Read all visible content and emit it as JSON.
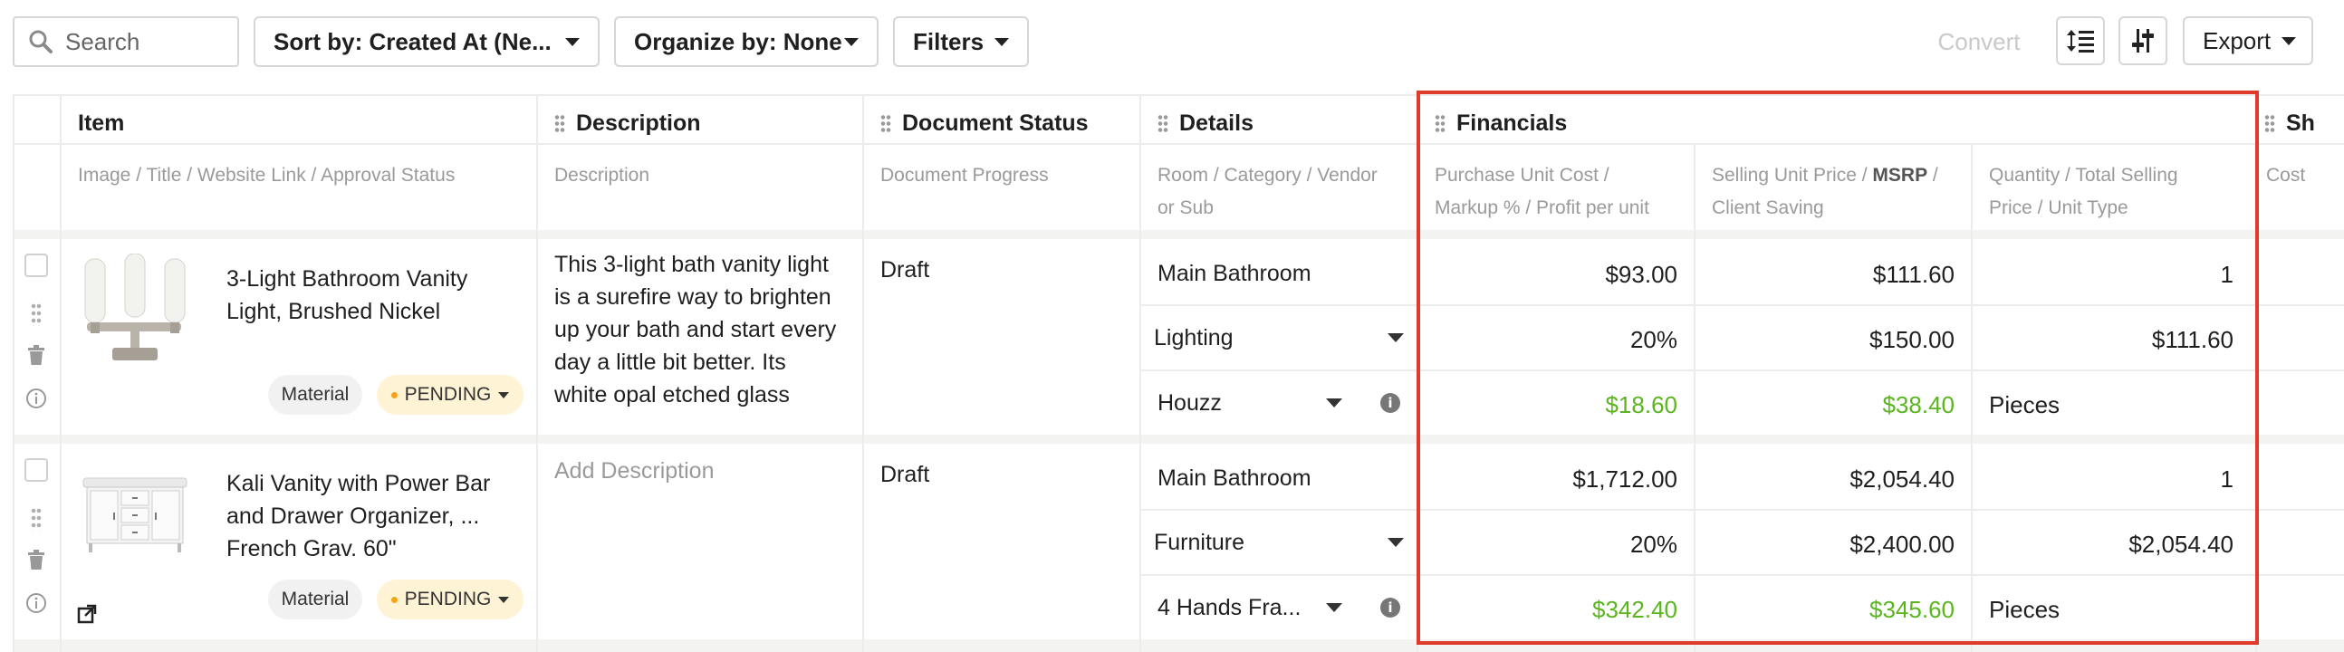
{
  "toolbar": {
    "search_placeholder": "Search",
    "sort_label": "Sort by: Created At (Ne...",
    "organize_label": "Organize by: None",
    "filters_label": "Filters",
    "convert_label": "Convert",
    "export_label": "Export"
  },
  "columns": {
    "item": {
      "title": "Item",
      "sub": "Image / Title / Website Link / Approval Status"
    },
    "description": {
      "title": "Description",
      "sub": "Description"
    },
    "document_status": {
      "title": "Document Status",
      "sub": "Document Progress"
    },
    "details": {
      "title": "Details",
      "sub_line1": "Room / Category / Vendor",
      "sub_line2": "or Sub"
    },
    "financials": {
      "title": "Financials"
    },
    "purchase": {
      "sub_line1": "Purchase Unit Cost /",
      "sub_line2": "Markup % / Profit per unit"
    },
    "selling": {
      "sub_a": "Selling Unit Price / ",
      "sub_bold": "MSRP",
      "sub_b": " /",
      "sub_line2": "Client Saving"
    },
    "quantity": {
      "sub_line1": "Quantity / Total Selling",
      "sub_line2": "Price / Unit Type"
    },
    "shipping": {
      "title": "Sh",
      "sub": "Cost"
    }
  },
  "rows": [
    {
      "title_line1": "3-Light Bathroom Vanity",
      "title_line2": "Light, Brushed Nickel",
      "title_line3": "",
      "type_badge": "Material",
      "status_badge": "PENDING",
      "description_lines": [
        "This 3-light bath vanity light",
        "is a surefire way to brighten",
        "up your bath and start every",
        "day a little bit better. Its",
        "white opal etched glass"
      ],
      "document_status": "Draft",
      "room": "Main Bathroom",
      "category": "Lighting",
      "vendor": "Houzz",
      "purchase_unit_cost": "$93.00",
      "markup": "20%",
      "profit_per_unit": "$18.60",
      "selling_unit_price": "$111.60",
      "msrp": "$150.00",
      "client_saving": "$38.40",
      "quantity": "1",
      "total_selling_price": "$111.60",
      "unit_type": "Pieces"
    },
    {
      "title_line1": "Kali Vanity with Power Bar",
      "title_line2": "and Drawer Organizer, ...",
      "title_line3": "French Grav. 60\"",
      "type_badge": "Material",
      "status_badge": "PENDING",
      "description_placeholder": "Add Description",
      "document_status": "Draft",
      "room": "Main Bathroom",
      "category": "Furniture",
      "vendor": "4 Hands Fra...",
      "purchase_unit_cost": "$1,712.00",
      "markup": "20%",
      "profit_per_unit": "$342.40",
      "selling_unit_price": "$2,054.40",
      "msrp": "$2,400.00",
      "client_saving": "$345.60",
      "quantity": "1",
      "total_selling_price": "$2,054.40",
      "unit_type": "Pieces"
    }
  ],
  "colors": {
    "highlight_border": "#e03a2a",
    "profit_green": "#5ab51f",
    "pending_bg": "#fff3d6"
  }
}
